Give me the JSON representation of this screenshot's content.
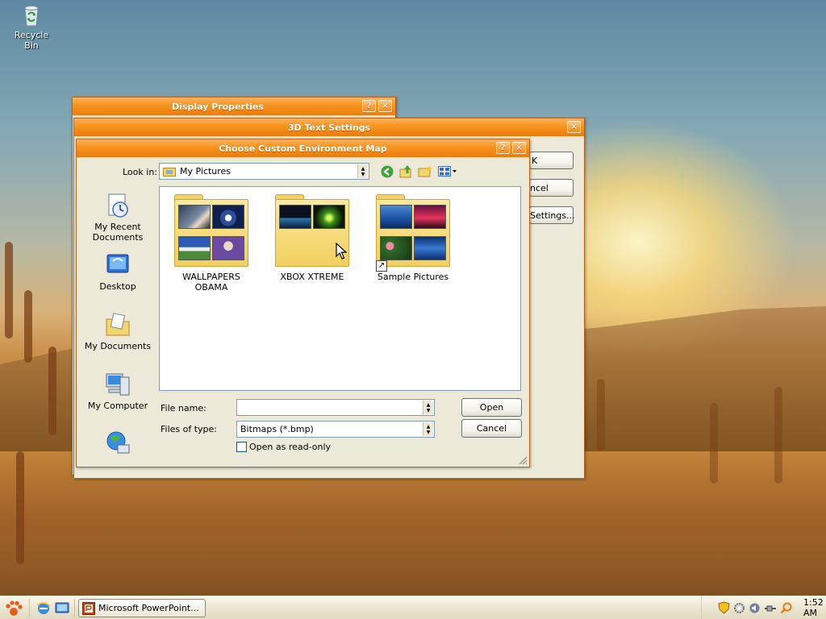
{
  "desktop": {
    "recycle_bin_label": "Recycle Bin"
  },
  "display_properties": {
    "title": "Display Properties",
    "help_btn": "?",
    "close_btn": "×"
  },
  "text3d_settings": {
    "title": "3D Text Settings",
    "close_btn": "×",
    "ok_label": "K",
    "cancel_label": "ncel",
    "settings_label": "Settings..."
  },
  "choose_map": {
    "title": "Choose Custom Environment Map",
    "help_btn": "?",
    "close_btn": "×",
    "look_in_label": "Look in:",
    "look_in_value": "My Pictures",
    "places": [
      {
        "label": "My Recent Documents",
        "icon": "recent-documents-icon"
      },
      {
        "label": "Desktop",
        "icon": "desktop-icon"
      },
      {
        "label": "My Documents",
        "icon": "my-documents-icon"
      },
      {
        "label": "My Computer",
        "icon": "my-computer-icon"
      },
      {
        "label": "",
        "icon": "my-network-places-icon"
      }
    ],
    "folders": [
      {
        "label": "WALLPAPERS OBAMA",
        "shortcut": false
      },
      {
        "label": "XBOX XTREME",
        "shortcut": false
      },
      {
        "label": "Sample Pictures",
        "shortcut": true
      }
    ],
    "file_name_label": "File name:",
    "file_name_value": "",
    "files_of_type_label": "Files of type:",
    "files_of_type_value": "Bitmaps (*.bmp)",
    "read_only_label": "Open as read-only",
    "read_only_checked": false,
    "open_label": "Open",
    "cancel_label": "Cancel"
  },
  "taskbar": {
    "task_label": "Microsoft PowerPoint...",
    "clock": "1:52 AM"
  },
  "colors": {
    "title_orange": "#f7931e",
    "dialog_bg": "#ece9d8",
    "taskbar_bg": "#ece6d2"
  }
}
